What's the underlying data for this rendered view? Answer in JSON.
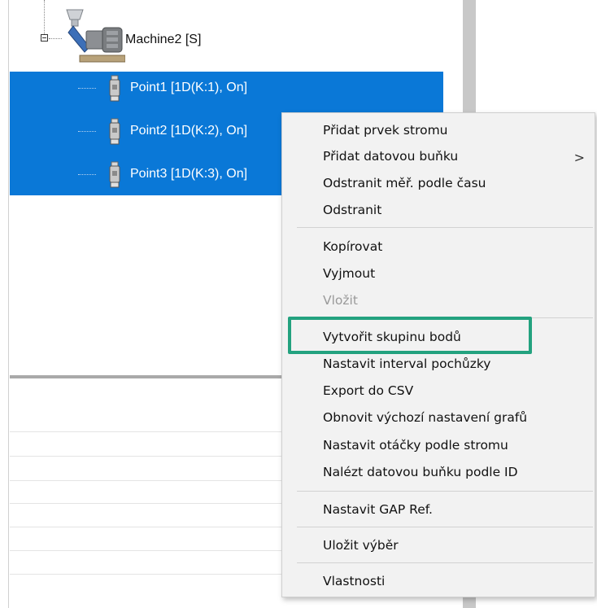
{
  "tree": {
    "machine": {
      "label": "Machine2 [S]",
      "icon": "machine-pump-icon"
    },
    "points": [
      {
        "label": "Point1 [1D(K:1), On]",
        "icon": "sensor-probe-icon"
      },
      {
        "label": "Point2 [1D(K:2), On]",
        "icon": "sensor-probe-icon"
      },
      {
        "label": "Point3 [1D(K:3), On]",
        "icon": "sensor-probe-icon"
      }
    ],
    "selection_color": "#0a78d7"
  },
  "context_menu": {
    "items": [
      {
        "label": "Přidat prvek stromu",
        "enabled": true
      },
      {
        "label": "Přidat datovou buňku",
        "enabled": true,
        "submenu_arrow": ">"
      },
      {
        "label": "Odstranit měř. podle času",
        "enabled": true
      },
      {
        "label": "Odstranit",
        "enabled": true
      },
      {
        "label": "Kopírovat",
        "enabled": true
      },
      {
        "label": "Vyjmout",
        "enabled": true
      },
      {
        "label": "Vložit",
        "enabled": false
      },
      {
        "label": "Vytvořit skupinu bodů",
        "enabled": true,
        "highlighted": true
      },
      {
        "label": "Nastavit interval pochůzky",
        "enabled": true
      },
      {
        "label": "Export do CSV",
        "enabled": true
      },
      {
        "label": "Obnovit výchozí nastavení grafů",
        "enabled": true
      },
      {
        "label": "Nastavit otáčky podle stromu",
        "enabled": true
      },
      {
        "label": "Nalézt datovou buňku podle ID",
        "enabled": true
      },
      {
        "label": "Nastavit GAP Ref.",
        "enabled": true
      },
      {
        "label": "Uložit výběr",
        "enabled": true
      },
      {
        "label": "Vlastnosti",
        "enabled": true
      }
    ],
    "highlight_color": "#23a27f"
  }
}
